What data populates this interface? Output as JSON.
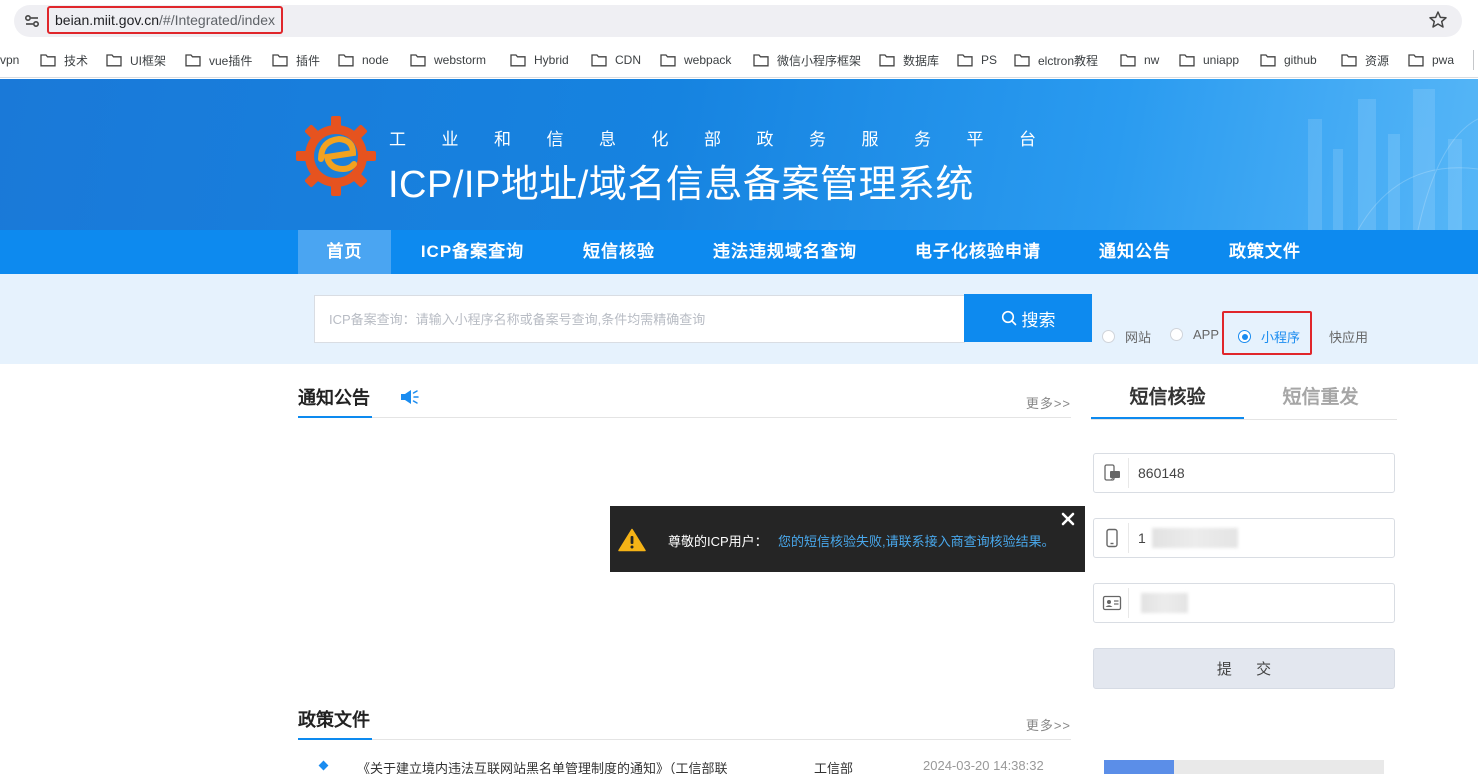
{
  "browser": {
    "url_host": "beian.miit.gov.cn",
    "url_path": "/#/Integrated/index",
    "bookmarks": [
      "vpn",
      "技术",
      "UI框架",
      "vue插件",
      "插件",
      "node",
      "webstorm",
      "Hybrid",
      "CDN",
      "webpack",
      "微信小程序框架",
      "数据库",
      "PS",
      "elctron教程",
      "nw",
      "uniapp",
      "github",
      "资源",
      "pwa"
    ]
  },
  "header": {
    "subtitle": "工业和信息化部政务服务平台",
    "title": "ICP/IP地址/域名信息备案管理系统"
  },
  "nav": {
    "items": [
      "首页",
      "ICP备案查询",
      "短信核验",
      "违法违规域名查询",
      "电子化核验申请",
      "通知公告",
      "政策文件"
    ]
  },
  "search": {
    "placeholder": "ICP备案查询：请输入小程序名称或备案号查询,条件均需精确查询",
    "button": "搜索",
    "options": [
      "网站",
      "APP",
      "小程序",
      "快应用"
    ],
    "selected": "小程序"
  },
  "notice": {
    "title": "通知公告",
    "more": "更多>>"
  },
  "policy": {
    "title": "政策文件",
    "more": "更多>>",
    "rows": [
      {
        "title": "《关于建立境内违法互联网站黑名单管理制度的通知》（工信部联",
        "org": "工信部",
        "date": "2024-03-20 14:38:32"
      }
    ]
  },
  "sms": {
    "tab_verify": "短信核验",
    "tab_resend": "短信重发",
    "code_value": "860148",
    "phone_value": "1",
    "submit": "提 交"
  },
  "toast": {
    "label": "尊敬的ICP用户：",
    "message": "您的短信核验失败,请联系接入商查询核验结果。"
  },
  "colors": {
    "primary": "#0d8aef",
    "nav_active": "#4aa5f2",
    "highlight_border": "#e0262b",
    "toast_bg": "#252525",
    "toast_link": "#49a8ec"
  }
}
